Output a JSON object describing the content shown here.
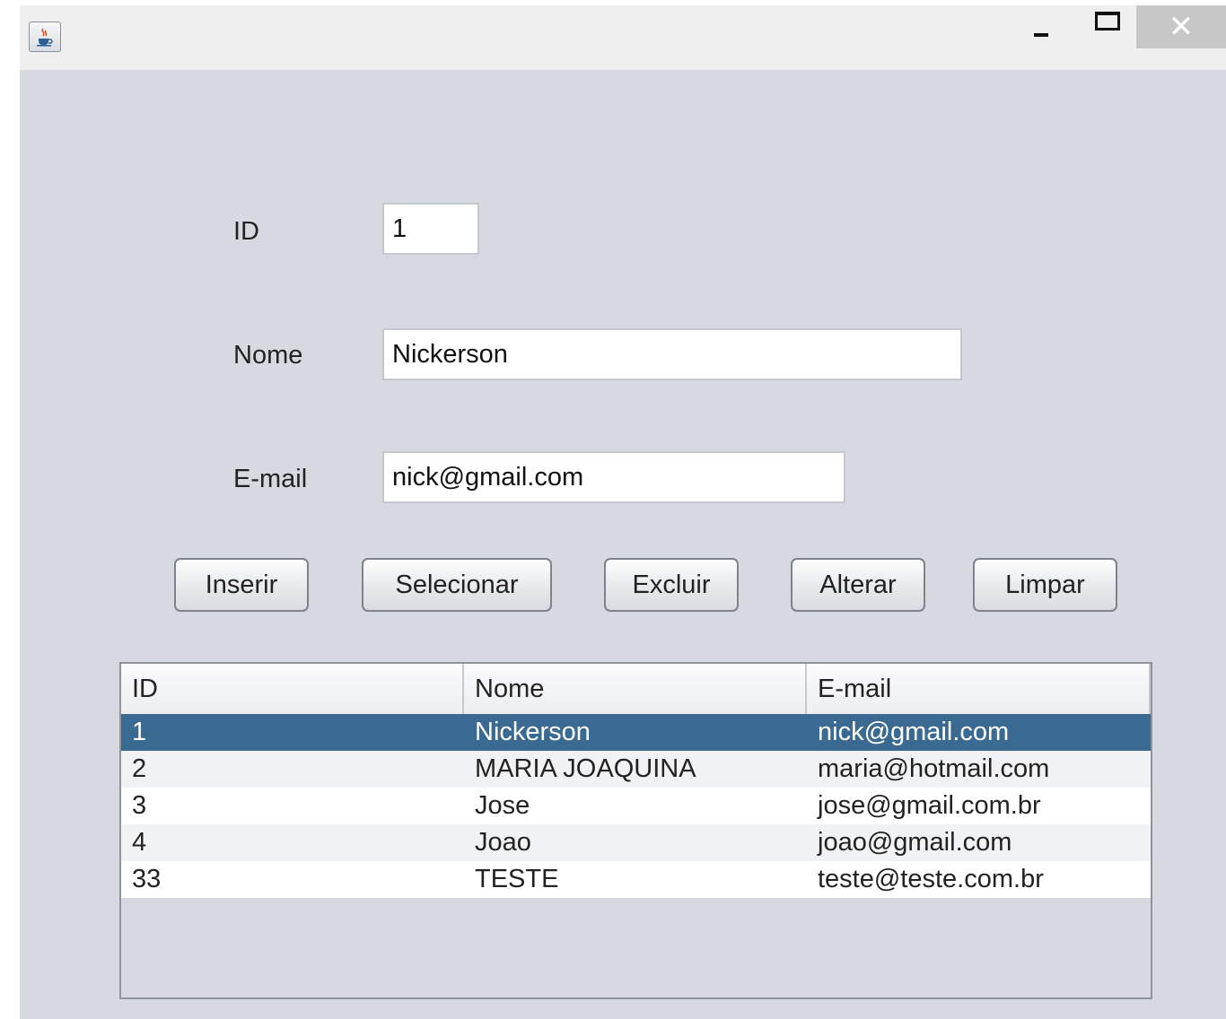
{
  "window": {
    "icon": "java-app-icon",
    "controls": [
      "minimize-icon",
      "maximize-icon",
      "close-icon"
    ],
    "close_glyph": "✕"
  },
  "form": {
    "id": {
      "label": "ID",
      "value": "1"
    },
    "nome": {
      "label": "Nome",
      "value": "Nickerson"
    },
    "email": {
      "label": "E-mail",
      "value": "nick@gmail.com"
    }
  },
  "buttons": {
    "inserir": "Inserir",
    "selecionar": "Selecionar",
    "excluir": "Excluir",
    "alterar": "Alterar",
    "limpar": "Limpar"
  },
  "table": {
    "columns": [
      "ID",
      "Nome",
      "E-mail"
    ],
    "selected_row": 0,
    "rows": [
      [
        "1",
        "Nickerson",
        "nick@gmail.com"
      ],
      [
        "2",
        "MARIA JOAQUINA",
        "maria@hotmail.com"
      ],
      [
        "3",
        "Jose",
        "jose@gmail.com.br"
      ],
      [
        "4",
        "Joao",
        "joao@gmail.com"
      ],
      [
        "33",
        "TESTE",
        "teste@teste.com.br"
      ]
    ]
  },
  "colors": {
    "background": "#d6d9e0",
    "selection": "#3a6a91",
    "titlebar": "#efefef"
  }
}
